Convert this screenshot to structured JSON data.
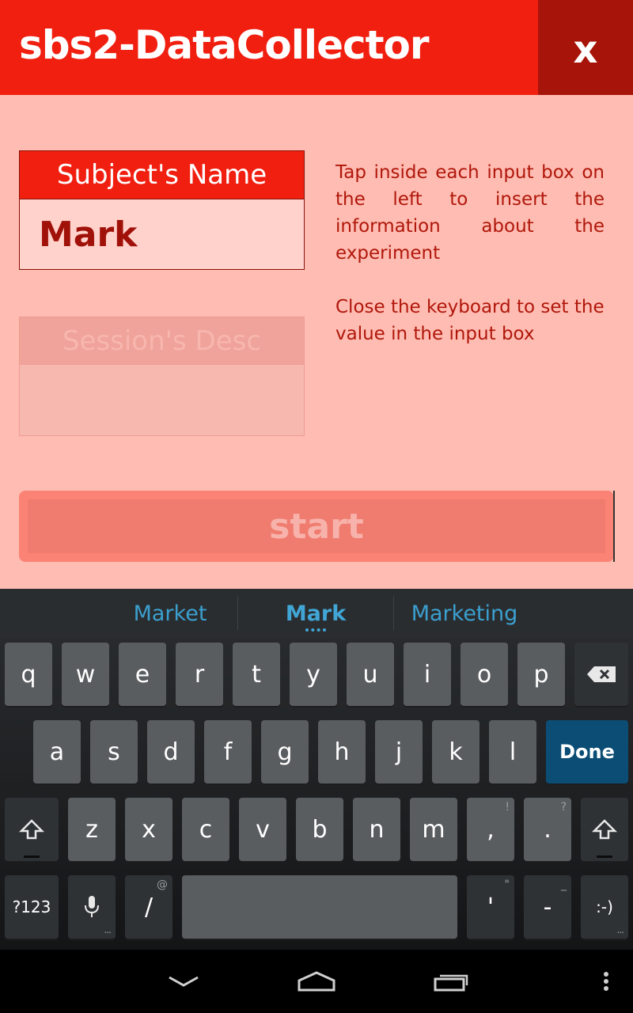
{
  "app": {
    "title": "sbs2-DataCollector",
    "close_label": "x",
    "subject_field": {
      "label": "Subject's Name",
      "value": "Mark"
    },
    "session_field": {
      "label": "Session's Desc",
      "value": ""
    },
    "help_text_1": "Tap inside each input box on the left to insert the information about the experiment",
    "help_text_2": "Close the keyboard to set the value in the input box",
    "start_label": "start"
  },
  "keyboard": {
    "suggestions": [
      "Market",
      "Mark",
      "Marketing"
    ],
    "row1": [
      "q",
      "w",
      "e",
      "r",
      "t",
      "y",
      "u",
      "i",
      "o",
      "p"
    ],
    "row2": [
      "a",
      "s",
      "d",
      "f",
      "g",
      "h",
      "j",
      "k",
      "l"
    ],
    "row3": [
      "z",
      "x",
      "c",
      "v",
      "b",
      "n",
      "m",
      ",",
      "."
    ],
    "row3_hints": {
      "comma": "!",
      "period": "?"
    },
    "done_label": "Done",
    "symbols_label": "?123",
    "slash_label": "/",
    "slash_hint": "@",
    "apostrophe_label": "'",
    "apostrophe_hint": "\"",
    "dash_label": "-",
    "dash_hint": "_",
    "smiley_label": ":-)",
    "icons": [
      "backspace-icon",
      "shift-icon",
      "mic-icon"
    ]
  },
  "navigation": {
    "icons": [
      "back-icon",
      "home-icon",
      "recents-icon",
      "menu-icon"
    ]
  },
  "colors": {
    "primary": "#f01f10",
    "primary_dark": "#a71409",
    "background": "#ffbcb2",
    "keyboard_accent": "#3ba0cf",
    "done_key": "#0b4d75"
  }
}
